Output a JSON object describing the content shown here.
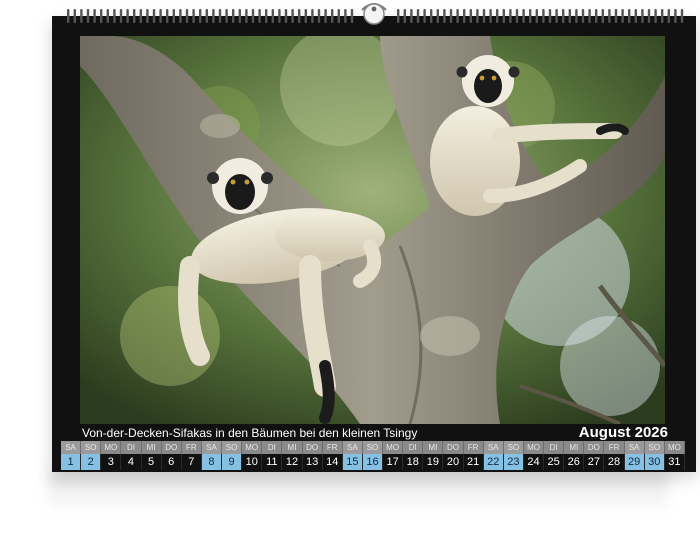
{
  "calendar": {
    "caption": "Von-der-Decken-Sifakas in den Bäumen bei den kleinen Tsingy",
    "month_label": "August 2026",
    "days": [
      {
        "dow": "SA",
        "num": "1",
        "weekend": true
      },
      {
        "dow": "SO",
        "num": "2",
        "weekend": true
      },
      {
        "dow": "MO",
        "num": "3",
        "weekend": false
      },
      {
        "dow": "DI",
        "num": "4",
        "weekend": false
      },
      {
        "dow": "MI",
        "num": "5",
        "weekend": false
      },
      {
        "dow": "DO",
        "num": "6",
        "weekend": false
      },
      {
        "dow": "FR",
        "num": "7",
        "weekend": false
      },
      {
        "dow": "SA",
        "num": "8",
        "weekend": true
      },
      {
        "dow": "SO",
        "num": "9",
        "weekend": true
      },
      {
        "dow": "MO",
        "num": "10",
        "weekend": false
      },
      {
        "dow": "DI",
        "num": "11",
        "weekend": false
      },
      {
        "dow": "MI",
        "num": "12",
        "weekend": false
      },
      {
        "dow": "DO",
        "num": "13",
        "weekend": false
      },
      {
        "dow": "FR",
        "num": "14",
        "weekend": false
      },
      {
        "dow": "SA",
        "num": "15",
        "weekend": true
      },
      {
        "dow": "SO",
        "num": "16",
        "weekend": true
      },
      {
        "dow": "MO",
        "num": "17",
        "weekend": false
      },
      {
        "dow": "DI",
        "num": "18",
        "weekend": false
      },
      {
        "dow": "MI",
        "num": "19",
        "weekend": false
      },
      {
        "dow": "DO",
        "num": "20",
        "weekend": false
      },
      {
        "dow": "FR",
        "num": "21",
        "weekend": false
      },
      {
        "dow": "SA",
        "num": "22",
        "weekend": true
      },
      {
        "dow": "SO",
        "num": "23",
        "weekend": true
      },
      {
        "dow": "MO",
        "num": "24",
        "weekend": false
      },
      {
        "dow": "DI",
        "num": "25",
        "weekend": false
      },
      {
        "dow": "MI",
        "num": "26",
        "weekend": false
      },
      {
        "dow": "DO",
        "num": "27",
        "weekend": false
      },
      {
        "dow": "FR",
        "num": "28",
        "weekend": false
      },
      {
        "dow": "SA",
        "num": "29",
        "weekend": true
      },
      {
        "dow": "SO",
        "num": "30",
        "weekend": true
      },
      {
        "dow": "MO",
        "num": "31",
        "weekend": false
      }
    ]
  },
  "colors": {
    "frame": "#111111",
    "weekend_highlight": "#86c0e3",
    "dow_bar": "#8a8a8a"
  },
  "icons": {
    "binding": "wire-binding-icon",
    "hanger": "hanger-hook-icon"
  }
}
